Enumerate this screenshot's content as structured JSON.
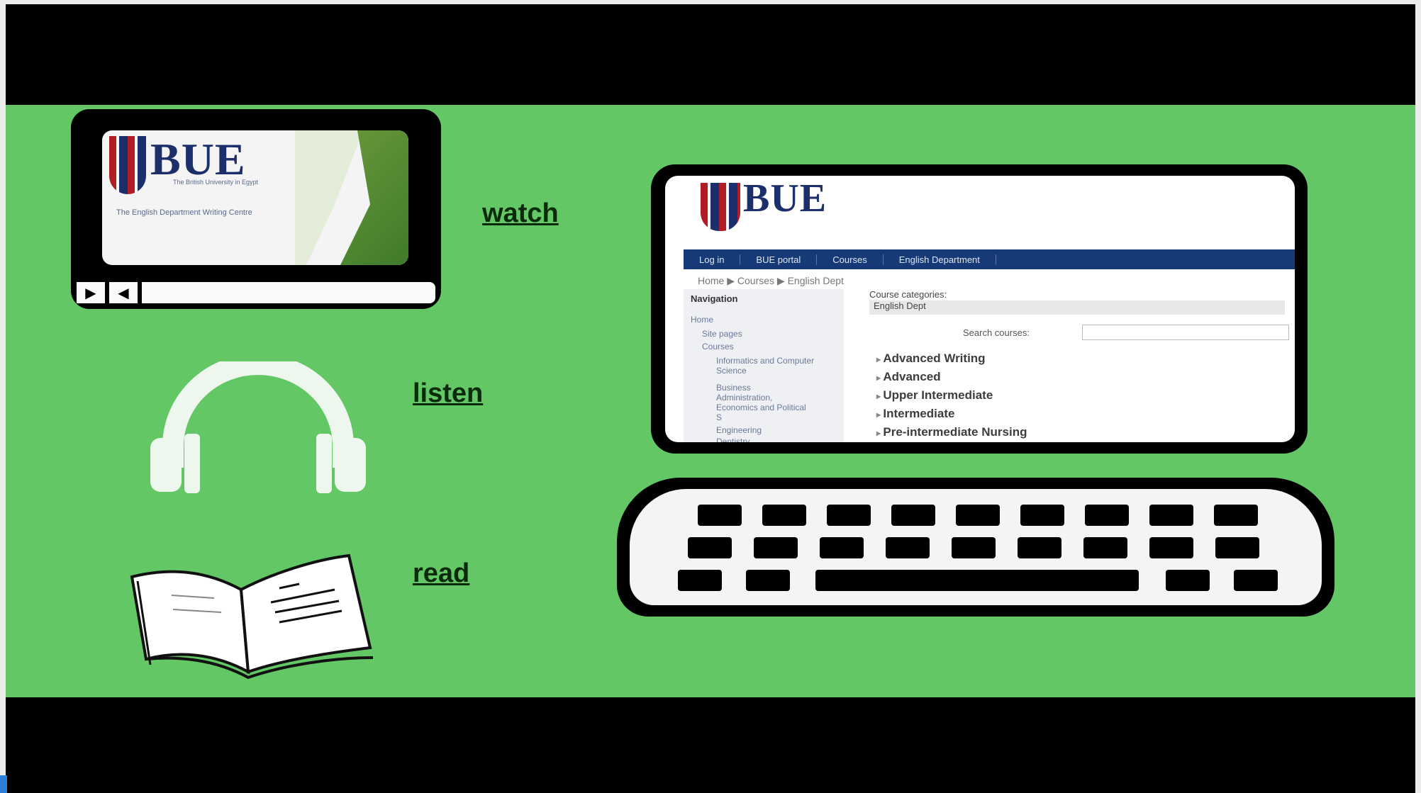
{
  "captions": {
    "watch": "watch",
    "listen": "listen",
    "read": "read"
  },
  "video": {
    "logo_text": "BUE",
    "subtitle": "The British University in Egypt",
    "title": "The English Department Writing Centre",
    "play_icon": "play-icon",
    "rewind_icon": "rewind-icon"
  },
  "laptop": {
    "logo_text": "BUE",
    "navbar": [
      "Log in",
      "BUE portal",
      "Courses",
      "English Department"
    ],
    "breadcrumb": "Home ▶ Courses ▶ English Dept",
    "navigation": {
      "title": "Navigation",
      "items": [
        "Home",
        "Site pages",
        "Courses",
        "Informatics and Computer Science",
        "Business Administration, Economics and Political S",
        "Engineering",
        "Dentistry"
      ]
    },
    "course_categories_label": "Course categories:",
    "course_categories_value": "English Dept",
    "search_label": "Search courses:",
    "courses": [
      "Advanced Writing",
      "Advanced",
      "Upper Intermediate",
      "Intermediate",
      "Pre-intermediate Nursing"
    ]
  },
  "colors": {
    "stage_green": "#64c766",
    "navbar_blue": "#163a78",
    "logo_navy": "#1c2f6b",
    "crest_red": "#b21c24"
  }
}
